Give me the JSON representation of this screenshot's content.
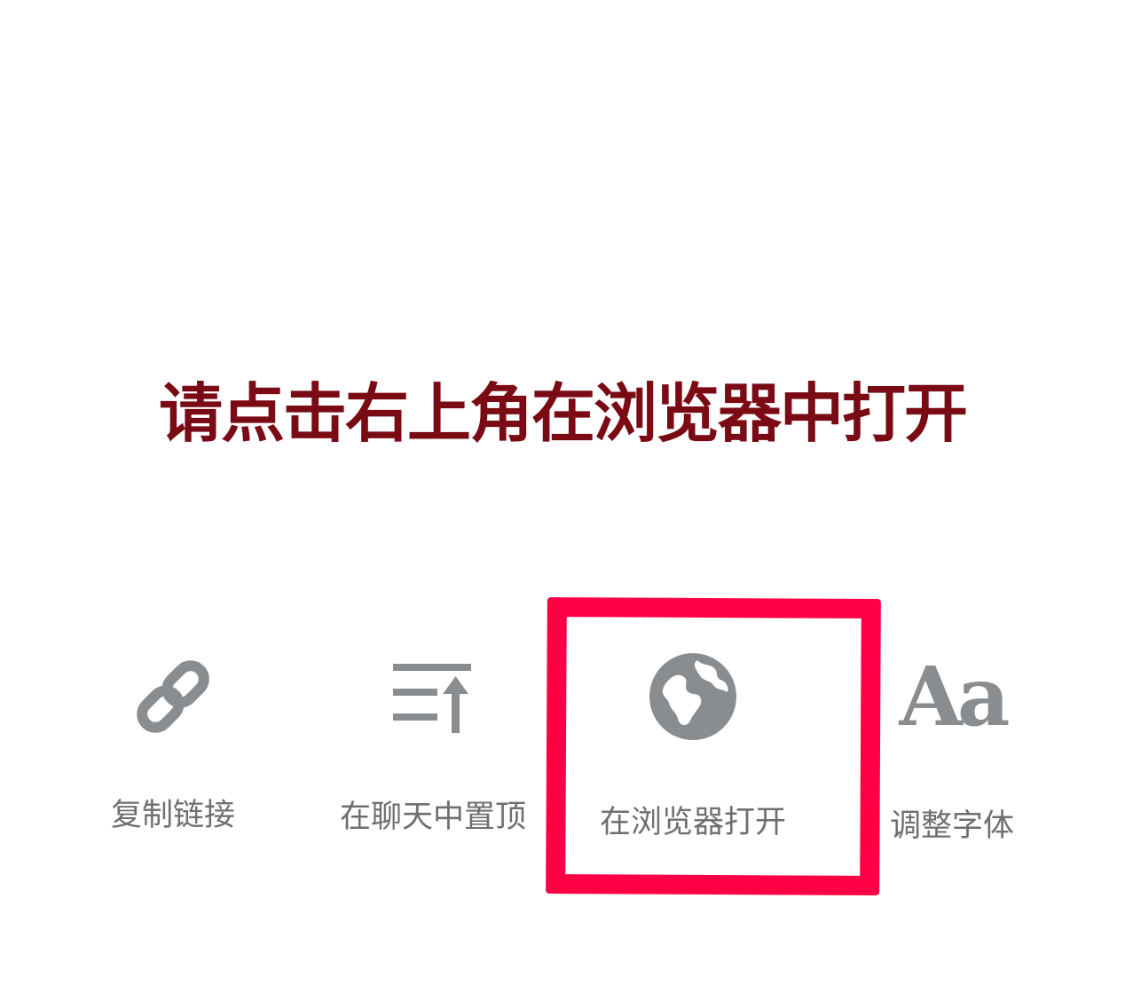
{
  "instruction": {
    "text": "请点击右上角在浏览器中打开",
    "color": "#7a0a14"
  },
  "menu": {
    "items": [
      {
        "label": "复制链接",
        "icon": "link-icon"
      },
      {
        "label": "在聊天中置顶",
        "icon": "pin-to-top-icon"
      },
      {
        "label": "在浏览器打开",
        "icon": "globe-icon"
      },
      {
        "label": "调整字体",
        "icon": "font-size-icon",
        "glyph": "Aa"
      }
    ],
    "icon_color": "#8a8d90",
    "label_color": "#6f6f6f"
  },
  "highlight": {
    "target": "在浏览器打开",
    "color": "#ff0044"
  }
}
